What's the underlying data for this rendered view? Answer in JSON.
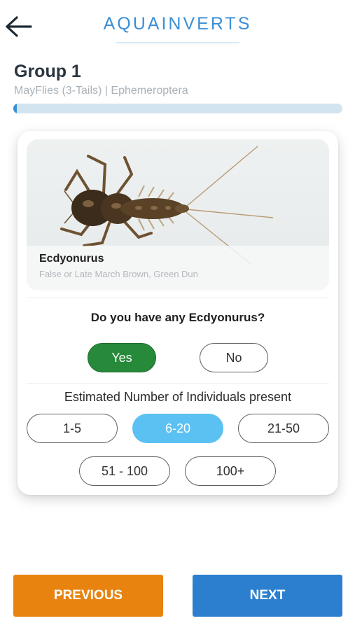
{
  "header": {
    "app_title": "AQUAINVERTS",
    "back_icon": "arrow-left-icon"
  },
  "group": {
    "title": "Group 1",
    "subtitle": "MayFlies (3-Tails) | Ephemeroptera",
    "progress": 0.01
  },
  "specimen": {
    "name": "Ecdyonurus",
    "common_names": "False or Late March Brown, Green Dun",
    "image": "mayfly-nymph-photo"
  },
  "presence_question": {
    "text": "Do you have any Ecdyonurus?",
    "options": [
      "Yes",
      "No"
    ],
    "selected": "Yes"
  },
  "estimate": {
    "label": "Estimated Number of Individuals present",
    "options": [
      "1-5",
      "6-20",
      "21-50",
      "51 - 100",
      "100+"
    ],
    "selected": "6-20"
  },
  "footer": {
    "previous_label": "PREVIOUS",
    "next_label": "NEXT"
  },
  "colors": {
    "accent_blue": "#3b8fd6",
    "yes_green": "#268a3a",
    "range_selected": "#5bc1f2",
    "previous_orange": "#e8830f",
    "next_blue": "#2b7fce"
  }
}
